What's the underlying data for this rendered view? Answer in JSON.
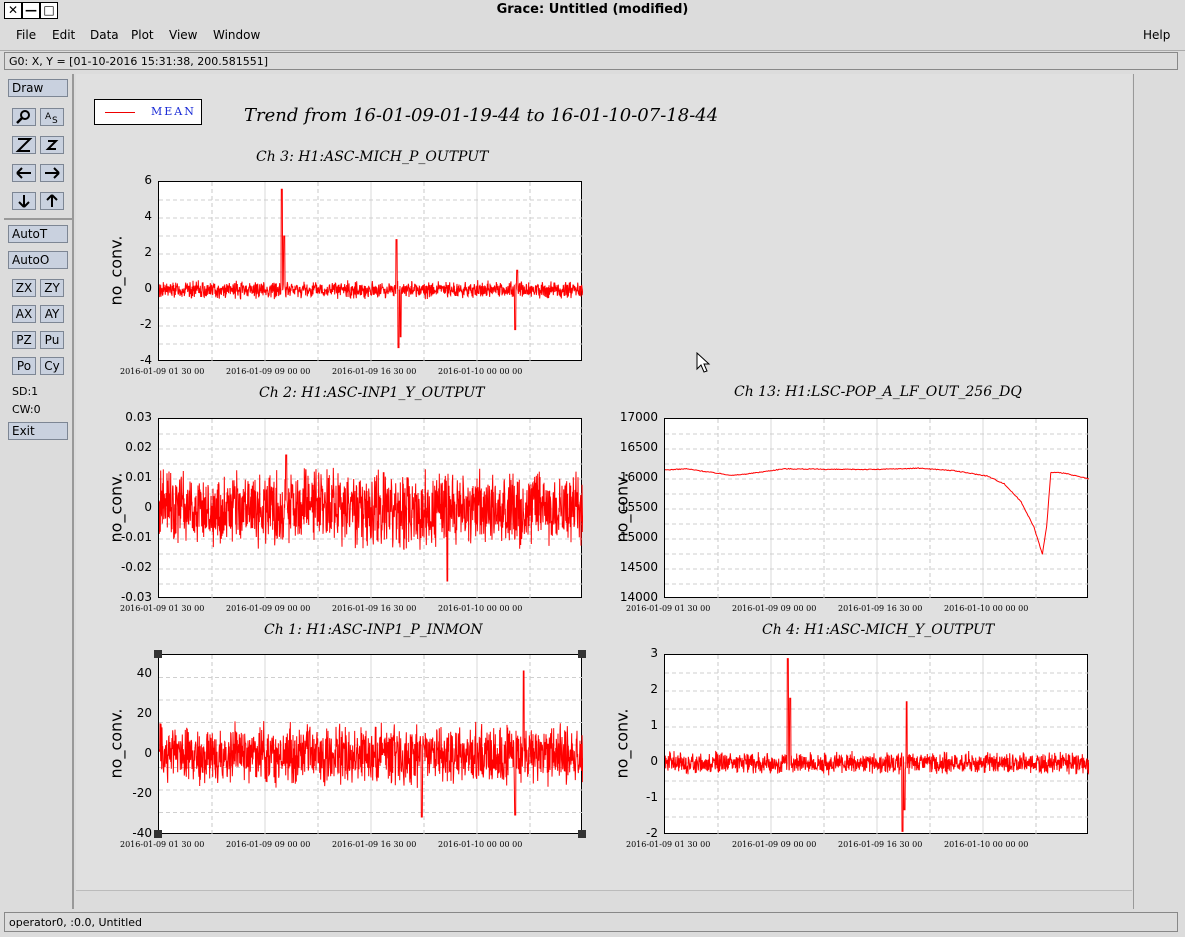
{
  "window": {
    "title": "Grace: Untitled (modified)",
    "controls": {
      "close": "✕",
      "minimize": "—",
      "maximize": "□"
    }
  },
  "menubar": {
    "items": [
      "File",
      "Edit",
      "Data",
      "Plot",
      "View",
      "Window"
    ],
    "help": "Help"
  },
  "locator": "G0: X, Y = [01-10-2016 15:31:38, 200.581551]",
  "toolbox": {
    "draw": "Draw",
    "autot": "AutoT",
    "autoo": "AutoO",
    "small_buttons": [
      "ZX",
      "ZY",
      "AX",
      "AY",
      "PZ",
      "Pu",
      "Po",
      "Cy"
    ],
    "sd": "SD:1",
    "cw": "CW:0",
    "exit": "Exit"
  },
  "statusbar": "operator0, :0.0, Untitled",
  "legend": {
    "label": "MEAN",
    "color": "#e00000"
  },
  "main_title": "Trend from 16-01-09-01-19-44 to 16-01-10-07-18-44",
  "chart_data": [
    {
      "type": "line",
      "title": "Ch 3: H1:ASC-MICH_P_OUTPUT",
      "ylabel": "no_conv.",
      "ylim": [
        -4,
        6
      ],
      "yticks": [
        "6",
        "4",
        "2",
        "0",
        "-2",
        "-4"
      ],
      "xticks": [
        "2016-01-09 01 30 00",
        "2016-01-09 09 00 00",
        "2016-01-09 16 30 00",
        "2016-01-10 00 00 00"
      ],
      "series": [
        {
          "color": "#ff0000",
          "noise": 0.35,
          "spikes": [
            [
              0.29,
              5.6
            ],
            [
              0.295,
              3.0
            ],
            [
              0.56,
              2.8
            ],
            [
              0.565,
              -3.2
            ],
            [
              0.57,
              -2.6
            ],
            [
              0.84,
              -2.2
            ],
            [
              0.845,
              1.1
            ]
          ],
          "baseline": 0
        }
      ]
    },
    {
      "type": "line",
      "title": "Ch 2: H1:ASC-INP1_Y_OUTPUT",
      "ylabel": "no_conv.",
      "ylim": [
        -0.03,
        0.03
      ],
      "yticks": [
        "0.03",
        "0.02",
        "0.01",
        "0",
        "-0.01",
        "-0.02",
        "-0.03"
      ],
      "xticks": [
        "2016-01-09 01 30 00",
        "2016-01-09 09 00 00",
        "2016-01-09 16 30 00",
        "2016-01-10 00 00 00"
      ],
      "series": [
        {
          "color": "#ff0000",
          "noise": 0.009,
          "spikes": [
            [
              0.68,
              -0.024
            ],
            [
              0.3,
              0.018
            ]
          ],
          "baseline": 0
        }
      ]
    },
    {
      "type": "line",
      "title": "Ch 13: H1:LSC-POP_A_LF_OUT_256_DQ",
      "ylabel": "no_conv.",
      "ylim": [
        14000,
        17000
      ],
      "yticks": [
        "17000",
        "16500",
        "16000",
        "15500",
        "15000",
        "14500",
        "14000"
      ],
      "xticks": [
        "2016-01-09 01 30 00",
        "2016-01-09 09 00 00",
        "2016-01-09 16 30 00",
        "2016-01-10 00 00 00"
      ],
      "series": [
        {
          "color": "#ff0000",
          "points": [
            [
              0,
              16150
            ],
            [
              0.05,
              16170
            ],
            [
              0.12,
              16100
            ],
            [
              0.16,
              16060
            ],
            [
              0.2,
              16090
            ],
            [
              0.28,
              16170
            ],
            [
              0.4,
              16160
            ],
            [
              0.5,
              16160
            ],
            [
              0.6,
              16180
            ],
            [
              0.68,
              16140
            ],
            [
              0.76,
              16050
            ],
            [
              0.8,
              15920
            ],
            [
              0.84,
              15620
            ],
            [
              0.87,
              15200
            ],
            [
              0.89,
              14750
            ],
            [
              0.9,
              15200
            ],
            [
              0.91,
              16110
            ],
            [
              0.94,
              16100
            ],
            [
              1.0,
              16000
            ]
          ]
        }
      ]
    },
    {
      "type": "line",
      "title": "Ch 1: H1:ASC-INP1_P_INMON",
      "ylabel": "no_conv.",
      "ylim": [
        -40,
        50
      ],
      "yticks": [
        "40",
        "20",
        "0",
        "-20",
        "-40"
      ],
      "xticks": [
        "2016-01-09 01 30 00",
        "2016-01-09 09 00 00",
        "2016-01-09 16 30 00",
        "2016-01-10 00 00 00"
      ],
      "series": [
        {
          "color": "#ff0000",
          "noise": 11,
          "spikes": [
            [
              0.86,
              42
            ],
            [
              0.62,
              -31
            ],
            [
              0.84,
              -30
            ]
          ],
          "baseline": 0
        }
      ]
    },
    {
      "type": "line",
      "title": "Ch 4: H1:ASC-MICH_Y_OUTPUT",
      "ylabel": "no_conv.",
      "ylim": [
        -2,
        3
      ],
      "yticks": [
        "3",
        "2",
        "1",
        "0",
        "-1",
        "-2"
      ],
      "xticks": [
        "2016-01-09 01 30 00",
        "2016-01-09 09 00 00",
        "2016-01-09 16 30 00",
        "2016-01-10 00 00 00"
      ],
      "series": [
        {
          "color": "#ff0000",
          "noise": 0.22,
          "spikes": [
            [
              0.29,
              2.9
            ],
            [
              0.295,
              1.8
            ],
            [
              0.56,
              -1.9
            ],
            [
              0.57,
              1.7
            ],
            [
              0.565,
              -1.3
            ]
          ],
          "baseline": 0
        }
      ]
    }
  ]
}
